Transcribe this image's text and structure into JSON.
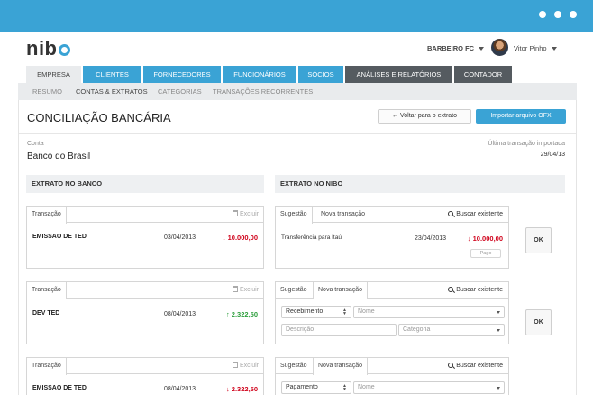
{
  "header": {
    "logo_text": "nib",
    "company": "BARBEIRO FC",
    "user": "Vitor Pinho",
    "colors": {
      "accent": "#3aa3d5",
      "dark_tab": "#555b60",
      "negative": "#d0021b",
      "positive": "#2a9d3a"
    }
  },
  "tabs": [
    {
      "label": "EMPRESA",
      "state": "active"
    },
    {
      "label": "CLIENTES",
      "state": "blue"
    },
    {
      "label": "FORNECEDORES",
      "state": "blue"
    },
    {
      "label": "FUNCIONÁRIOS",
      "state": "blue"
    },
    {
      "label": "SÓCIOS",
      "state": "blue"
    },
    {
      "label": "ANÁLISES E RELATÓRIOS",
      "state": "dark"
    },
    {
      "label": "CONTADOR",
      "state": "dark"
    }
  ],
  "subnav": [
    {
      "label": "RESUMO",
      "active": false
    },
    {
      "label": "CONTAS & EXTRATOS",
      "active": true
    },
    {
      "label": "CATEGORIAS",
      "active": false
    },
    {
      "label": "TRANSAÇÕES RECORRENTES",
      "active": false
    }
  ],
  "page": {
    "title": "CONCILIAÇÃO BANCÁRIA",
    "back_button": "Voltar para o extrato",
    "import_button": "Importar arquivo OFX",
    "account_label": "Conta",
    "account_value": "Banco do Brasil",
    "last_import_label": "Última transação importada",
    "last_import_value": "29/04/13"
  },
  "sections": {
    "bank": "EXTRATO NO BANCO",
    "nibo": "EXTRATO NO NIBO"
  },
  "card_labels": {
    "transacao": "Transação",
    "excluir": "Excluir",
    "sugestao": "Sugestão",
    "nova": "Nova transação",
    "buscar": "Buscar existente",
    "ok": "OK"
  },
  "rows": [
    {
      "bank": {
        "desc": "EMISSAO DE TED",
        "date": "03/04/2013",
        "value": "↓ 10.000,00",
        "sign": "neg"
      },
      "nibo": {
        "active_tab": "sugestao",
        "suggestion": {
          "desc": "Transferência para Itaú",
          "date": "23/04/2013",
          "value": "↓ 10.000,00",
          "badge": "Pago"
        }
      }
    },
    {
      "bank": {
        "desc": "DEV TED",
        "date": "08/04/2013",
        "value": "↑ 2.322,50",
        "sign": "pos"
      },
      "nibo": {
        "active_tab": "nova",
        "form": {
          "type": "Recebimento",
          "name_placeholder": "Nome",
          "desc_placeholder": "Descrição",
          "cat_placeholder": "Categoria"
        }
      }
    },
    {
      "bank": {
        "desc": "EMISSAO DE TED",
        "date": "08/04/2013",
        "value": "↓ 2.322,50",
        "sign": "neg"
      },
      "nibo": {
        "active_tab": "nova",
        "form": {
          "type": "Pagamento",
          "name_placeholder": "Nome"
        }
      }
    }
  ]
}
